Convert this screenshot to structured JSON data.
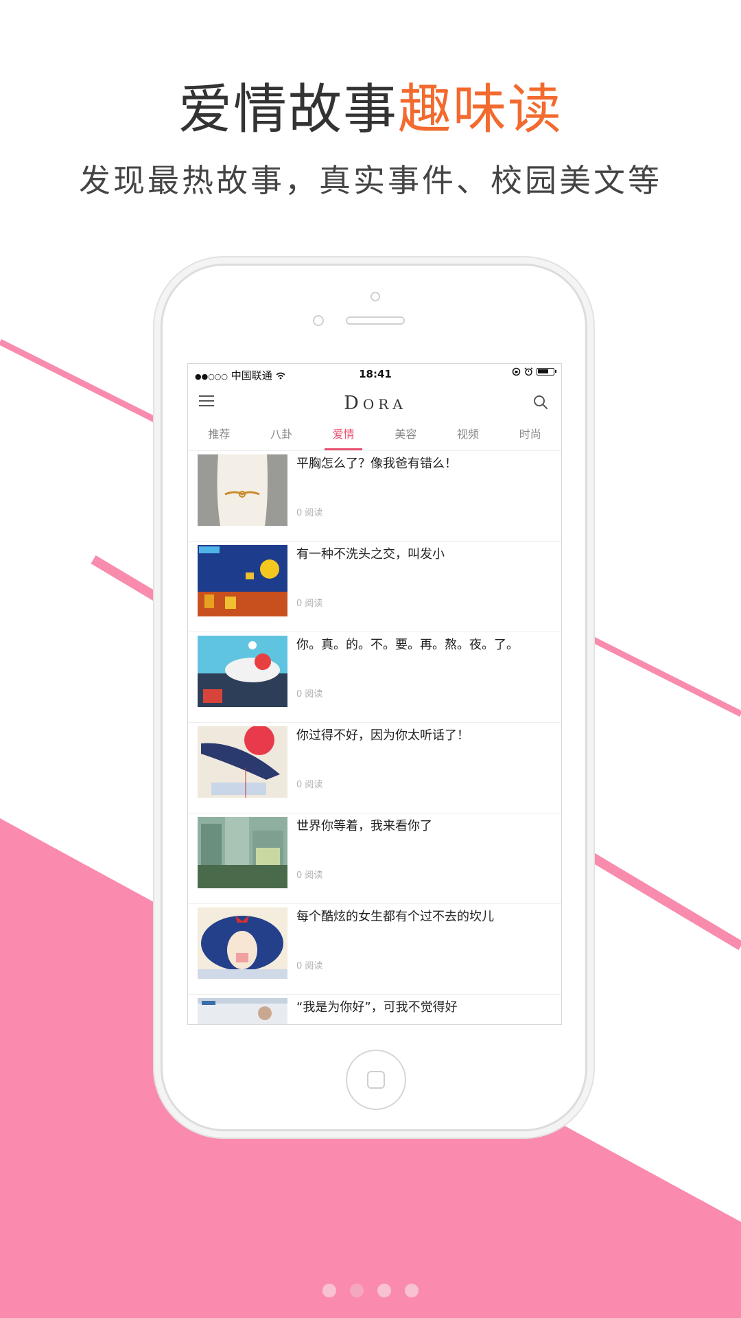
{
  "hero": {
    "headline_main": "爱情故事",
    "headline_accent": "趣味读",
    "subtitle": "发现最热故事，真实事件、校园美文等"
  },
  "colors": {
    "accent_orange": "#f26a2e",
    "brand_pink": "#f98bad",
    "tab_active": "#e8506f"
  },
  "status_bar": {
    "signal": "●●○○○",
    "carrier": "中国联通",
    "time": "18:41"
  },
  "app": {
    "brand_initial": "D",
    "brand_rest": "ORA",
    "menu_icon": "hamburger-icon",
    "search_icon": "search-icon"
  },
  "tabs": [
    {
      "label": "推荐",
      "active": false
    },
    {
      "label": "八卦",
      "active": false
    },
    {
      "label": "爱情",
      "active": true
    },
    {
      "label": "美容",
      "active": false
    },
    {
      "label": "视频",
      "active": false
    },
    {
      "label": "时尚",
      "active": false
    }
  ],
  "articles": [
    {
      "title": "平胸怎么了？像我爸有错么！",
      "reads": "0 阅读"
    },
    {
      "title": "有一种不洗头之交，叫发小",
      "reads": "0 阅读"
    },
    {
      "title": "你。真。的。不。要。再。熬。夜。了。",
      "reads": "0 阅读"
    },
    {
      "title": "你过得不好，因为你太听话了！",
      "reads": "0 阅读"
    },
    {
      "title": "世界你等着，我来看你了",
      "reads": "0 阅读"
    },
    {
      "title": "每个酷炫的女生都有个过不去的坎儿",
      "reads": "0 阅读"
    },
    {
      "title": "“我是为你好”，可我不觉得好",
      "reads": ""
    }
  ],
  "pager": {
    "count": 4,
    "active_index": 1
  }
}
